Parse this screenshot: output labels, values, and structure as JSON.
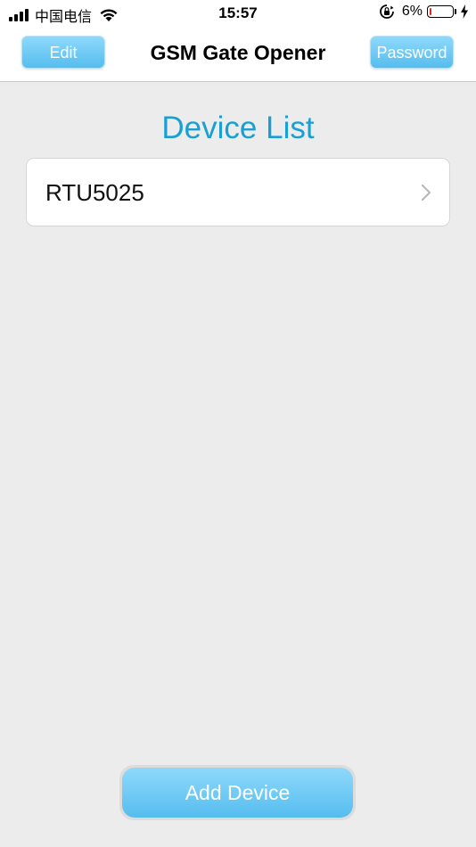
{
  "status_bar": {
    "carrier": "中国电信",
    "time": "15:57",
    "battery_percent": "6%",
    "battery_level": 0.06,
    "battery_fill_color": "#e0261f"
  },
  "nav": {
    "edit_label": "Edit",
    "title": "GSM Gate Opener",
    "password_label": "Password"
  },
  "main": {
    "section_title": "Device List",
    "devices": [
      {
        "name": "RTU5025"
      }
    ],
    "add_button_label": "Add Device"
  },
  "colors": {
    "accent": "#1a9fd4",
    "button_top": "#8fd9fb",
    "button_bottom": "#55bdee",
    "background": "#ececec"
  },
  "icons": [
    "signal-icon",
    "wifi-icon",
    "rotation-lock-icon",
    "battery-icon",
    "charging-bolt-icon",
    "chevron-right-icon"
  ]
}
